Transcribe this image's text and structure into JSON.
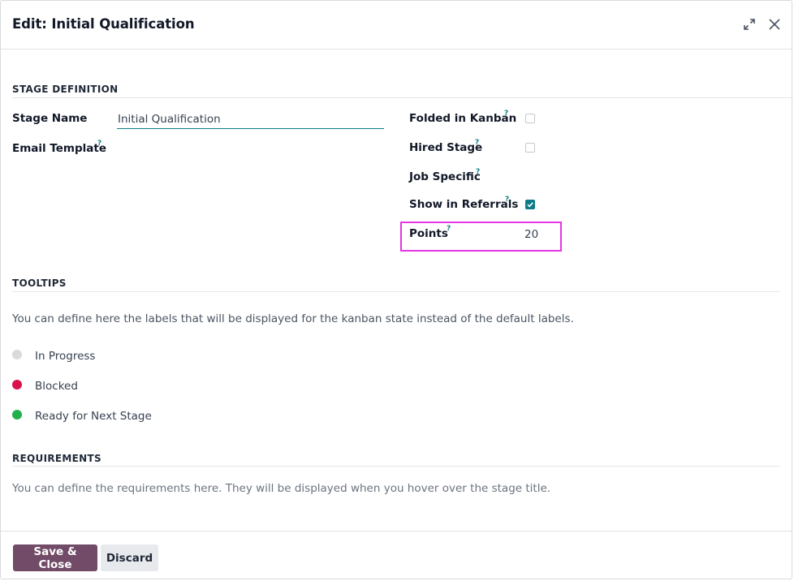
{
  "dialog": {
    "title": "Edit: Initial Qualification",
    "expand_icon": "expand-icon",
    "close_icon": "close-icon"
  },
  "stage_definition": {
    "section_title": "STAGE DEFINITION",
    "stage_name_label": "Stage Name",
    "stage_name_value": "Initial Qualification",
    "email_template_label": "Email Template",
    "help_mark": "?",
    "folded_in_kanban_label": "Folded in Kanban",
    "folded_in_kanban_checked": false,
    "hired_stage_label": "Hired Stage",
    "hired_stage_checked": false,
    "job_specific_label": "Job Specific",
    "show_in_referrals_label": "Show in Referrals",
    "show_in_referrals_checked": true,
    "points_label": "Points",
    "points_value": "20"
  },
  "tooltips": {
    "section_title": "TOOLTIPS",
    "description": "You can define here the labels that will be displayed for the kanban state instead of the default labels.",
    "states": [
      {
        "label": "In Progress",
        "color": "#d9dadc"
      },
      {
        "label": "Blocked",
        "color": "#d9134e"
      },
      {
        "label": "Ready for Next Stage",
        "color": "#21b04b"
      }
    ]
  },
  "requirements": {
    "section_title": "REQUIREMENTS",
    "placeholder": "You can define the requirements here. They will be displayed when you hover over the stage title."
  },
  "footer": {
    "save_label": "Save & Close",
    "discard_label": "Discard"
  },
  "colors": {
    "primary": "#714b67",
    "accent": "#0e7c86",
    "highlight": "#e535e5"
  }
}
